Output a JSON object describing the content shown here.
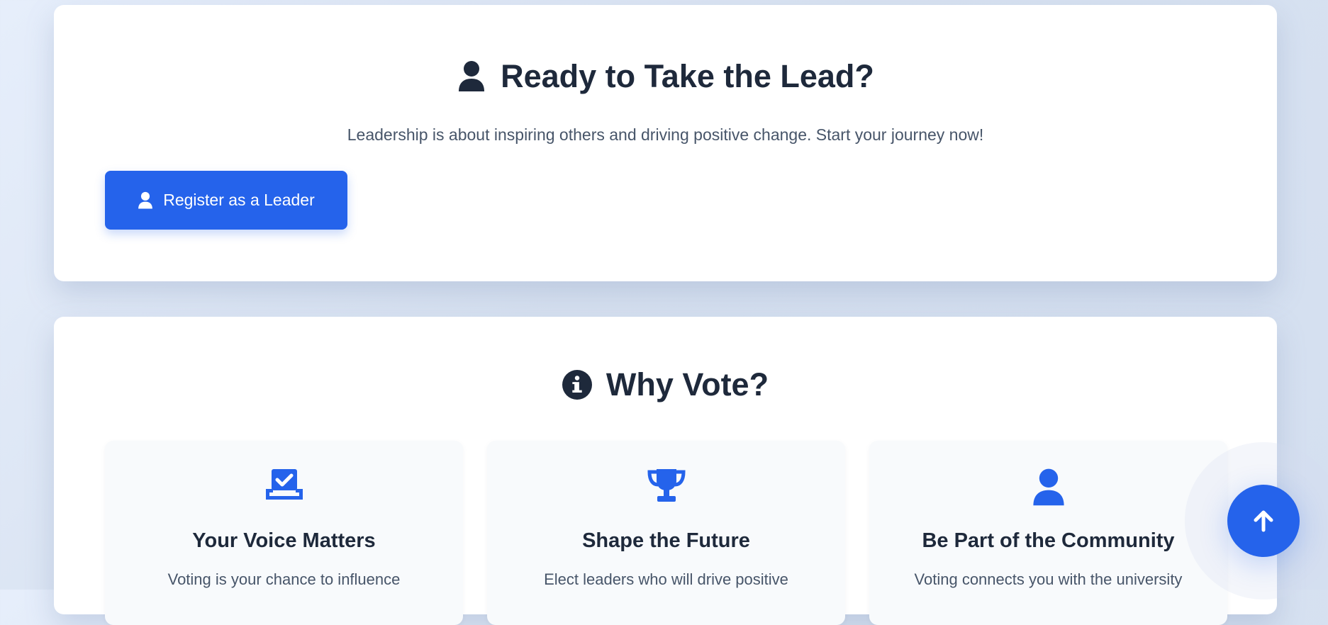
{
  "lead_section": {
    "title": "Ready to Take the Lead?",
    "title_icon": "user-icon",
    "subtitle": "Leadership is about inspiring others and driving positive change. Start your journey now!",
    "register_button_label": "Register as a Leader",
    "register_button_icon": "user-icon"
  },
  "vote_section": {
    "title": "Why Vote?",
    "title_icon": "info-circle-icon",
    "features": [
      {
        "icon": "vote-box-icon",
        "title": "Your Voice Matters",
        "text": "Voting is your chance to influence"
      },
      {
        "icon": "trophy-icon",
        "title": "Shape the Future",
        "text": "Elect leaders who will drive positive"
      },
      {
        "icon": "user-icon",
        "title": "Be Part of the Community",
        "text": "Voting connects you with the university"
      }
    ]
  },
  "scroll_top_button": {
    "icon": "arrow-up-icon"
  },
  "colors": {
    "accent": "#2563eb",
    "heading": "#1e293b",
    "body_text": "#475569",
    "card_background": "#ffffff",
    "feature_background": "#f8fafc"
  }
}
